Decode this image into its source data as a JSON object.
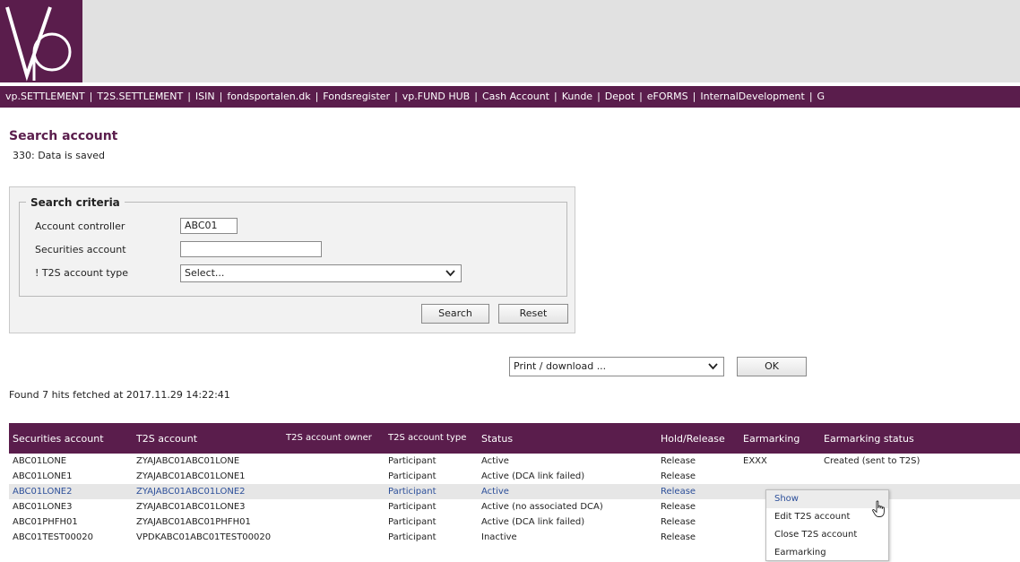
{
  "header": {
    "logo_text": "vp",
    "nav_items": [
      "vp.SETTLEMENT",
      "T2S.SETTLEMENT",
      "ISIN",
      "fondsportalen.dk",
      "Fondsregister",
      "vp.FUND HUB",
      "Cash Account",
      "Kunde",
      "Depot",
      "eFORMS",
      "InternalDevelopment",
      "G"
    ],
    "nav_separator": "|"
  },
  "page": {
    "title": "Search account",
    "status_message": "330: Data is saved"
  },
  "search": {
    "legend": "Search criteria",
    "account_controller_label": "Account controller",
    "account_controller_value": "ABC01",
    "securities_account_label": "Securities account",
    "securities_account_value": "",
    "t2s_type_label": "! T2S account type",
    "t2s_type_selected": "Select...",
    "search_button": "Search",
    "reset_button": "Reset"
  },
  "download": {
    "selected": "Print / download ...",
    "ok_button": "OK"
  },
  "results": {
    "hits_text": "Found 7 hits fetched at 2017.11.29 14:22:41",
    "columns": [
      "Securities account",
      "T2S account",
      "T2S account owner",
      "T2S account type",
      "Status",
      "Hold/Release",
      "Earmarking",
      "Earmarking status"
    ],
    "rows": [
      [
        "ABC01LONE",
        "ZYAJABC01ABC01LONE",
        "",
        "Participant",
        "Active",
        "Release",
        "EXXX",
        "Created (sent to T2S)"
      ],
      [
        "ABC01LONE1",
        "ZYAJABC01ABC01LONE1",
        "",
        "Participant",
        "Active (DCA link failed)",
        "Release",
        "",
        ""
      ],
      [
        "ABC01LONE2",
        "ZYAJABC01ABC01LONE2",
        "",
        "Participant",
        "Active",
        "Release",
        "",
        ""
      ],
      [
        "ABC01LONE3",
        "ZYAJABC01ABC01LONE3",
        "",
        "Participant",
        "Active (no associated DCA)",
        "Release",
        "",
        ""
      ],
      [
        "ABC01PHFH01",
        "ZYAJABC01ABC01PHFH01",
        "",
        "Participant",
        "Active (DCA link failed)",
        "Release",
        "",
        ""
      ],
      [
        "ABC01TEST00020",
        "VPDKABC01ABC01TEST00020",
        "",
        "Participant",
        "Inactive",
        "Release",
        "",
        ""
      ]
    ]
  },
  "context_menu": {
    "items": [
      "Show",
      "Edit T2S account",
      "Close T2S account",
      "Earmarking"
    ]
  },
  "colors": {
    "brand": "#5a1d4c",
    "banner": "#e1e1e1",
    "panel": "#f2f2f2",
    "link_highlight": "#2c4f9a"
  },
  "icons": {
    "dropdown": "chevron-down-icon",
    "cursor": "hand-pointer-icon"
  }
}
